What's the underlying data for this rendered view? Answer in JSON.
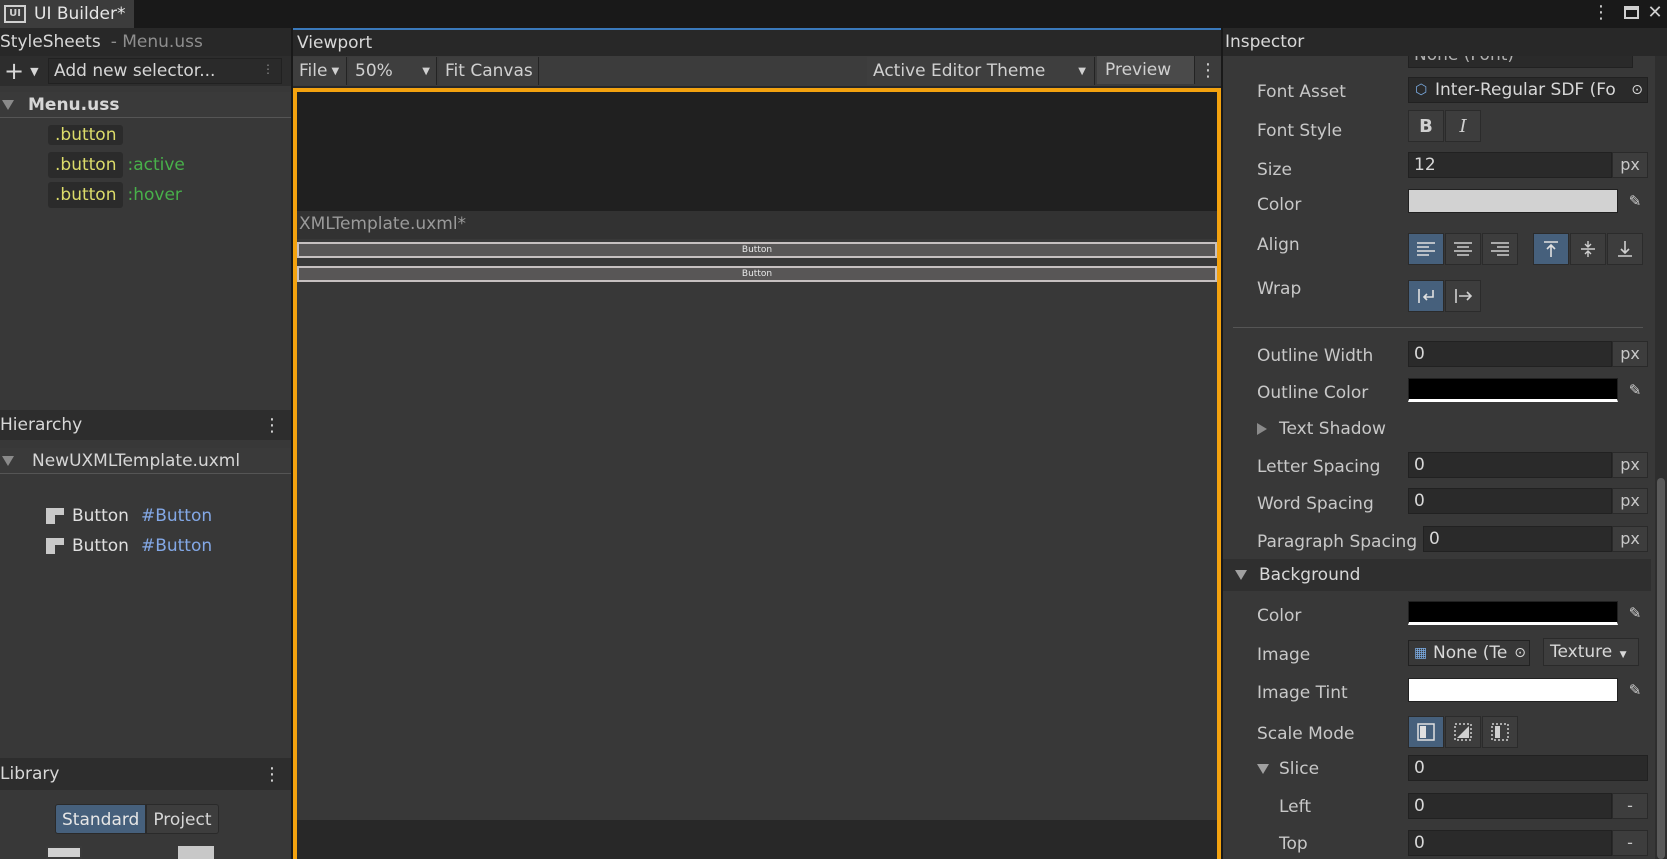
{
  "window": {
    "tab_title": "UI Builder*",
    "icon_text": "UI"
  },
  "stylesheets": {
    "title": "StyleSheets",
    "subtitle": "- Menu.uss",
    "add_placeholder": "Add new selector...",
    "file": "Menu.uss",
    "selectors": [
      {
        "name": ".button",
        "pseudo": ""
      },
      {
        "name": ".button",
        "pseudo": ":active"
      },
      {
        "name": ".button",
        "pseudo": ":hover"
      }
    ]
  },
  "hierarchy": {
    "title": "Hierarchy",
    "root": "NewUXMLTemplate.uxml",
    "items": [
      {
        "type": "Button",
        "name": "#Button"
      },
      {
        "type": "Button",
        "name": "#Button"
      }
    ]
  },
  "library": {
    "title": "Library",
    "tabs": [
      "Standard",
      "Project"
    ],
    "active_tab": "Standard"
  },
  "viewport": {
    "title": "Viewport",
    "file_menu": "File",
    "zoom": "50%",
    "fit_canvas": "Fit Canvas",
    "theme": "Active Editor Theme",
    "preview": "Preview",
    "document_title": "XMLTemplate.uxml*",
    "buttons": [
      "Button",
      "Button"
    ]
  },
  "inspector": {
    "title": "Inspector",
    "font_cut": "None (Font)",
    "font_asset_label": "Font Asset",
    "font_asset_value": "Inter-Regular SDF (Fo",
    "font_style_label": "Font Style",
    "size_label": "Size",
    "size_value": "12",
    "unit": "px",
    "color_label": "Color",
    "color_value": "#d2d2d2",
    "align_label": "Align",
    "wrap_label": "Wrap",
    "outline_width_label": "Outline Width",
    "outline_width_value": "0",
    "outline_color_label": "Outline Color",
    "outline_color_value": "#000000",
    "text_shadow_label": "Text Shadow",
    "letter_spacing_label": "Letter Spacing",
    "letter_spacing_value": "0",
    "word_spacing_label": "Word Spacing",
    "word_spacing_value": "0",
    "paragraph_spacing_label": "Paragraph Spacing",
    "paragraph_spacing_value": "0",
    "background_section": "Background",
    "bg_color_label": "Color",
    "bg_color_value": "#000000",
    "image_label": "Image",
    "image_value": "None (Te",
    "image_type": "Texture",
    "image_tint_label": "Image Tint",
    "image_tint_value": "#ffffff",
    "scale_mode_label": "Scale Mode",
    "slice_label": "Slice",
    "slice_value": "0",
    "left_label": "Left",
    "left_value": "0",
    "top_label": "Top",
    "top_value": "0",
    "minus": "-"
  },
  "colors": {
    "canvas_border": "#f3a20f",
    "active_toggle": "#46607c",
    "selector_text": "#dcdc6a",
    "pseudo_text": "#48b04a",
    "id_text": "#83a8e6"
  }
}
